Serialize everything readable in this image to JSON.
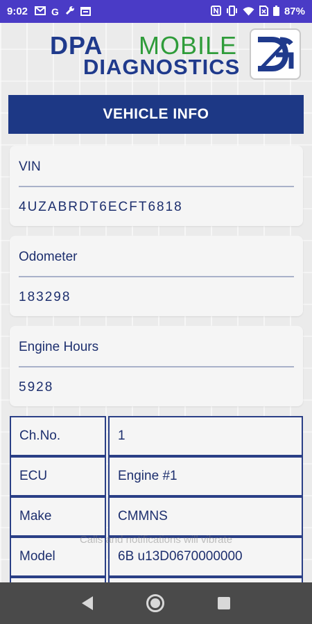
{
  "status_bar": {
    "time": "9:02",
    "left_icons": [
      "gmail-icon",
      "google-icon",
      "wrench-icon",
      "calendar-icon"
    ],
    "right_icons": [
      "nfc-icon",
      "vibrate-icon",
      "wifi-icon",
      "no-sim-icon",
      "battery-icon"
    ],
    "battery": "87%"
  },
  "header": {
    "logo_dpa": "DPA",
    "logo_mobile": "MOBILE",
    "logo_diagnostics": "DIAGNOSTICS",
    "colors": {
      "blue": "#1f3a8c",
      "green": "#2f9c3a"
    }
  },
  "title": "VEHICLE INFO",
  "cards": [
    {
      "label": "VIN",
      "value": "4UZABRDT6ECFT6818"
    },
    {
      "label": "Odometer",
      "value": "183298"
    },
    {
      "label": "Engine Hours",
      "value": "5928"
    }
  ],
  "table": [
    {
      "key": "Ch.No.",
      "value": "1"
    },
    {
      "key": "ECU",
      "value": "Engine #1"
    },
    {
      "key": "Make",
      "value": "CMMNS"
    },
    {
      "key": "Model",
      "value": "6B u13D0670000000"
    }
  ],
  "toast": "Calls and notifications will vibrate",
  "nav": [
    "back-icon",
    "home-icon",
    "recents-icon"
  ],
  "colors": {
    "status_bar": "#4a3bc6",
    "title_bar": "#1d3885",
    "nav_bar": "#4a4a4a"
  }
}
